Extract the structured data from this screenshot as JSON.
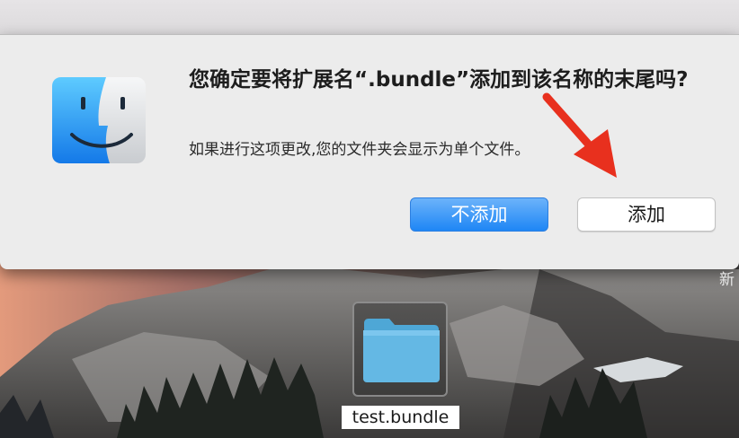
{
  "alert": {
    "title": "您确定要将扩展名“.bundle”添加到该名称的末尾吗?",
    "message": "如果进行这项更改,您的文件夹会显示为单个文件。",
    "cancel_label": "不添加",
    "confirm_label": "添加",
    "icon": "finder-icon"
  },
  "desktop": {
    "side_label": "新",
    "folder": {
      "name": "test.bundle",
      "icon": "folder-icon"
    }
  },
  "annotation": {
    "icon": "red-arrow-icon"
  },
  "colors": {
    "accent": "#1e86f5",
    "alert_bg": "#ececec",
    "arrow": "#e8301e",
    "folder": "#64b8e4"
  }
}
